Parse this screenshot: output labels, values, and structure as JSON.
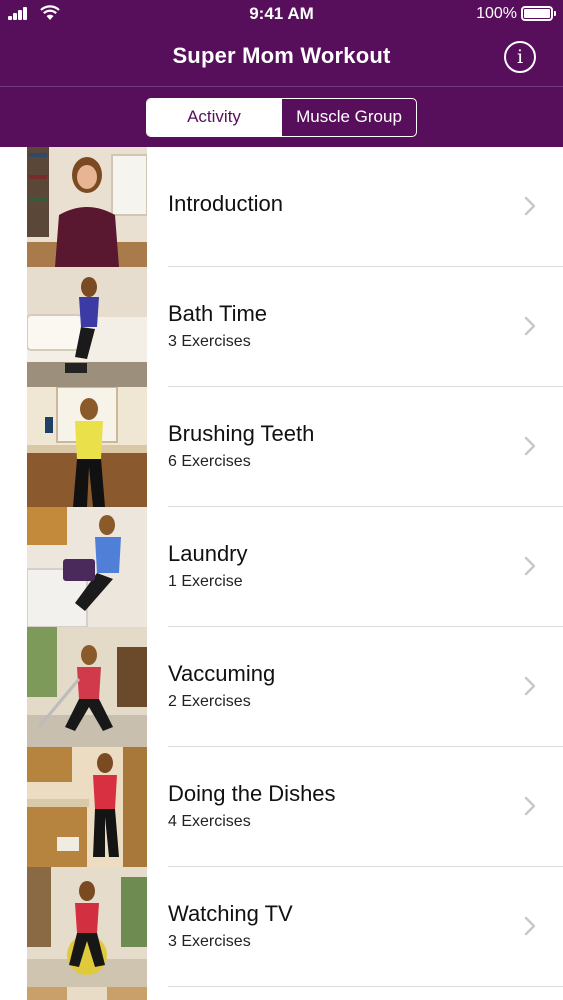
{
  "status_bar": {
    "time": "9:41 AM",
    "battery": "100%"
  },
  "nav": {
    "title": "Super Mom Workout"
  },
  "segments": {
    "activity": "Activity",
    "muscle_group": "Muscle Group",
    "selected": "Activity"
  },
  "items": [
    {
      "title": "Introduction",
      "subtitle": ""
    },
    {
      "title": "Bath Time",
      "subtitle": "3 Exercises"
    },
    {
      "title": "Brushing Teeth",
      "subtitle": "6 Exercises"
    },
    {
      "title": "Laundry",
      "subtitle": "1 Exercise"
    },
    {
      "title": "Vaccuming",
      "subtitle": "2 Exercises"
    },
    {
      "title": "Doing the Dishes",
      "subtitle": "4 Exercises"
    },
    {
      "title": "Watching TV",
      "subtitle": "3 Exercises"
    }
  ],
  "colors": {
    "header": "#570f5c",
    "separator": "#dcdcdc",
    "chevron": "#c7c7cc"
  }
}
